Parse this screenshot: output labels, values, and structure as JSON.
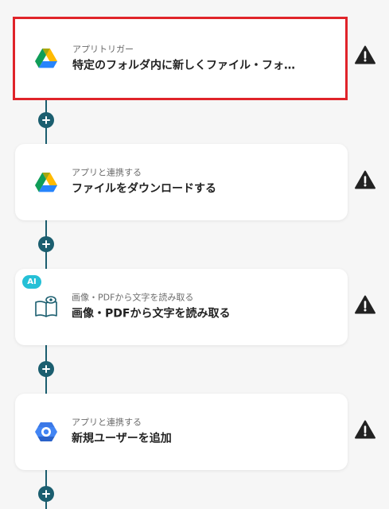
{
  "colors": {
    "connector": "#1b5e6f",
    "selected_border": "#e0242a",
    "ai_badge": "#25c0d6",
    "warning": "#222222"
  },
  "flow": {
    "steps": [
      {
        "subtitle": "アプリトリガー",
        "title": "特定のフォルダ内に新しくファイル・フォ…",
        "icon": "google-drive-icon",
        "selected": true,
        "warning": true
      },
      {
        "subtitle": "アプリと連携する",
        "title": "ファイルをダウンロードする",
        "icon": "google-drive-icon",
        "selected": false,
        "warning": true
      },
      {
        "subtitle": "画像・PDFから文字を読み取る",
        "title": "画像・PDFから文字を読み取る",
        "icon": "ocr-book-icon",
        "badge": "AI",
        "selected": false,
        "warning": true
      },
      {
        "subtitle": "アプリと連携する",
        "title": "新規ユーザーを追加",
        "icon": "google-workspace-icon",
        "selected": false,
        "warning": true
      }
    ]
  }
}
